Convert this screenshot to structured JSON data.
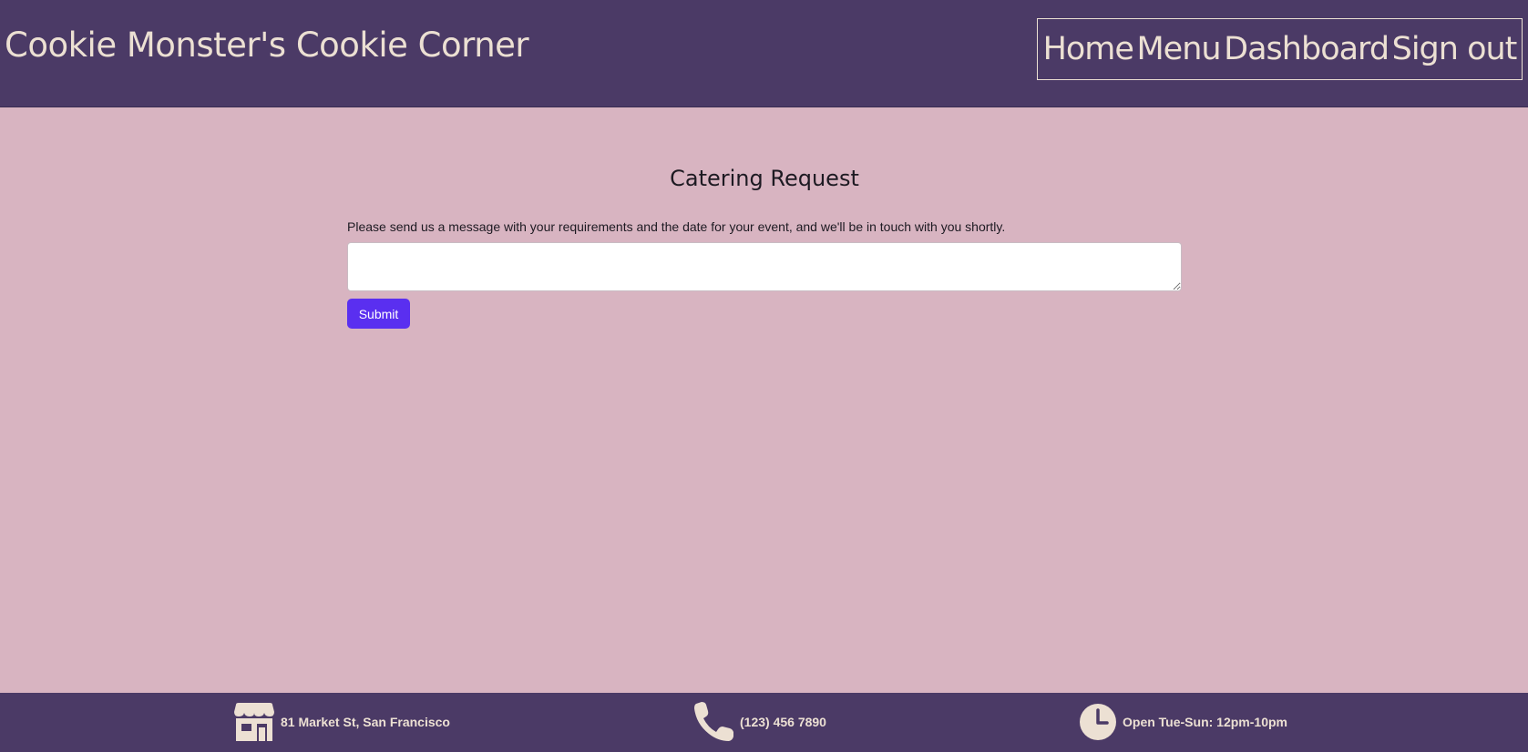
{
  "header": {
    "site_title": "Cookie Monster's Cookie Corner",
    "nav": [
      {
        "label": "Home"
      },
      {
        "label": "Menu"
      },
      {
        "label": "Dashboard"
      },
      {
        "label": "Sign out"
      }
    ]
  },
  "main": {
    "title": "Catering Request",
    "instructions": "Please send us a message with your requirements and the date for your event, and we'll be in touch with you shortly.",
    "message_value": "",
    "submit_label": "Submit"
  },
  "footer": {
    "address": {
      "icon": "store-icon",
      "text": "81 Market St, San Francisco"
    },
    "phone": {
      "icon": "phone-icon",
      "text": "(123) 456 7890"
    },
    "hours": {
      "icon": "clock-icon",
      "text": "Open Tue-Sun: 12pm-10pm"
    }
  },
  "colors": {
    "header_bg": "#4b3a66",
    "page_bg": "#d8b4c1",
    "accent_button": "#5a2ff0",
    "header_text": "#ece0d3"
  }
}
